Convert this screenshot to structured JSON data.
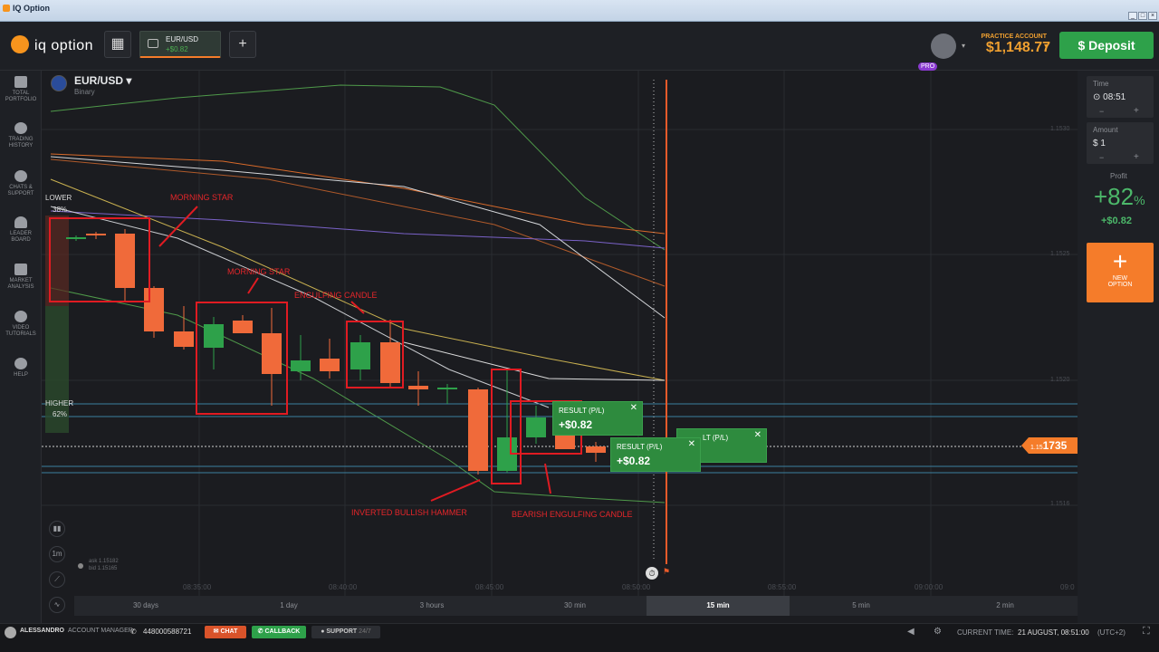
{
  "window": {
    "title": "IQ Option"
  },
  "header": {
    "brand": "iq option",
    "asset_tab": {
      "name": "EUR/USD",
      "pl": "+$0.82"
    },
    "account_type": "PRACTICE ACCOUNT",
    "balance": "$1,148.77",
    "pro_badge": "PRO",
    "deposit_label": "Deposit"
  },
  "sidebar": {
    "items": [
      {
        "label": "TOTAL PORTFOLIO",
        "icon": "briefcase-icon"
      },
      {
        "label": "TRADING HISTORY",
        "icon": "clock-icon"
      },
      {
        "label": "CHATS & SUPPORT",
        "icon": "chat-icon"
      },
      {
        "label": "LEADER BOARD",
        "icon": "user-icon"
      },
      {
        "label": "MARKET ANALYSIS",
        "icon": "news-icon"
      },
      {
        "label": "VIDEO TUTORIALS",
        "icon": "play-icon"
      },
      {
        "label": "HELP",
        "icon": "help-icon"
      }
    ]
  },
  "chart": {
    "asset": "EUR/USD",
    "asset_type": "Binary",
    "lower_label": "LOWER",
    "lower_pct": "38%",
    "higher_label": "HIGHER",
    "higher_pct": "62%",
    "ask": "ask 1.15182",
    "bid": "bid 1.15165",
    "current_price": "1.15",
    "current_price_tail": "1735",
    "y_ticks": [
      "1.1530",
      "1.1525",
      "1.1520",
      "1.1516"
    ],
    "x_ticks": [
      "08:35:00",
      "08:40:00",
      "08:45:00",
      "08:50:00",
      "08:55:00",
      "09:00:00",
      "09:0"
    ],
    "timeframe_selector": "1m",
    "annotations": [
      "MORNING STAR",
      "MORNING STAR",
      "ENGULFING CANDLE",
      "INVERTED BULLISH HAMMER",
      "BEARISH ENGULFING CANDLE"
    ],
    "results": [
      {
        "title": "RESULT (P/L)",
        "value": "+$0.82"
      },
      {
        "title": "RESULT (P/L)",
        "value": "+$0.82"
      },
      {
        "title": "LT (P/L)",
        "value": ""
      }
    ]
  },
  "right_panel": {
    "time_label": "Time",
    "time_value": "08:51",
    "amount_label": "Amount",
    "amount_value": "$ 1",
    "profit_label": "Profit",
    "profit_pct": "+82",
    "profit_pct_sign": "%",
    "profit_usd": "+$0.82",
    "new_option": "NEW OPTION"
  },
  "timeframes": [
    "30 days",
    "1 day",
    "3 hours",
    "30 min",
    "15 min",
    "5 min",
    "2 min"
  ],
  "active_timeframe": "15 min",
  "footer": {
    "user": "ALESSANDRO",
    "account_manager": "ACCOUNT MANAGER",
    "phone": "448000588721",
    "chat": "CHAT",
    "callback": "CALLBACK",
    "support": "SUPPORT",
    "support_hours": "24/7",
    "current_time_label": "CURRENT TIME:",
    "current_time": "21 AUGUST, 08:51:00",
    "timezone": "(UTC+2)"
  },
  "colors": {
    "up": "#2ea14a",
    "down": "#f06a3a",
    "accent": "#f57c2a",
    "annotation": "#e01b22"
  }
}
